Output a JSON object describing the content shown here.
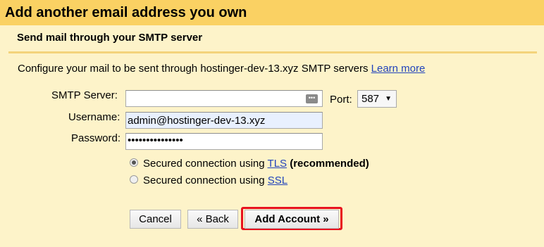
{
  "dialog": {
    "title": "Add another email address you own",
    "subtitle": "Send mail through your SMTP server",
    "description": "Configure your mail to be sent through hostinger-dev-13.xyz SMTP servers",
    "learn_more": "Learn more"
  },
  "form": {
    "smtp_server": {
      "label": "SMTP Server:",
      "value": ""
    },
    "port": {
      "label": "Port:",
      "value": "587"
    },
    "username": {
      "label": "Username:",
      "value": "admin@hostinger-dev-13.xyz"
    },
    "password": {
      "label": "Password:",
      "masked_value": "•••••••••••••••"
    },
    "security": {
      "tls": {
        "prefix": "Secured connection using",
        "link": "TLS",
        "suffix": "(recommended)",
        "selected": true
      },
      "ssl": {
        "prefix": "Secured connection using",
        "link": "SSL",
        "selected": false
      }
    }
  },
  "buttons": {
    "cancel": "Cancel",
    "back": "« Back",
    "add_account": "Add Account »"
  },
  "colors": {
    "title_bar": "#fad163",
    "background": "#fdf3c9",
    "highlight": "#e8121f",
    "link": "#2244bb"
  }
}
